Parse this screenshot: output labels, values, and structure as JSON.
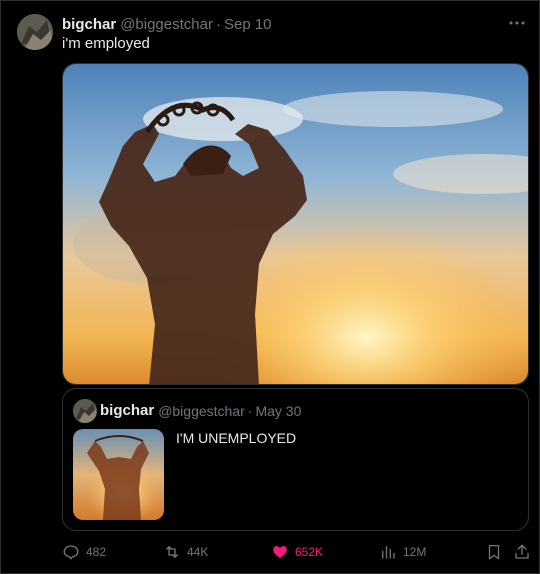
{
  "tweet": {
    "author_name": "bigchar",
    "author_handle": "@biggestchar",
    "separator": "·",
    "date": "Sep 10",
    "text": "i'm employed"
  },
  "quoted_tweet": {
    "author_name": "bigchar",
    "author_handle": "@biggestchar",
    "separator": "·",
    "date": "May 30",
    "text": "I'M UNEMPLOYED"
  },
  "actions": {
    "replies": "482",
    "reposts": "44K",
    "likes": "652K",
    "views": "12M"
  },
  "colors": {
    "background": "#000000",
    "text_primary": "#e7e9ea",
    "text_secondary": "#71767b",
    "like_active": "#f91880",
    "border": "#2f3336"
  },
  "icons": {
    "more": "more-dots-icon",
    "reply": "reply-icon",
    "repost": "repost-icon",
    "like": "heart-icon",
    "views": "views-icon",
    "bookmark": "bookmark-icon",
    "share": "share-icon"
  }
}
